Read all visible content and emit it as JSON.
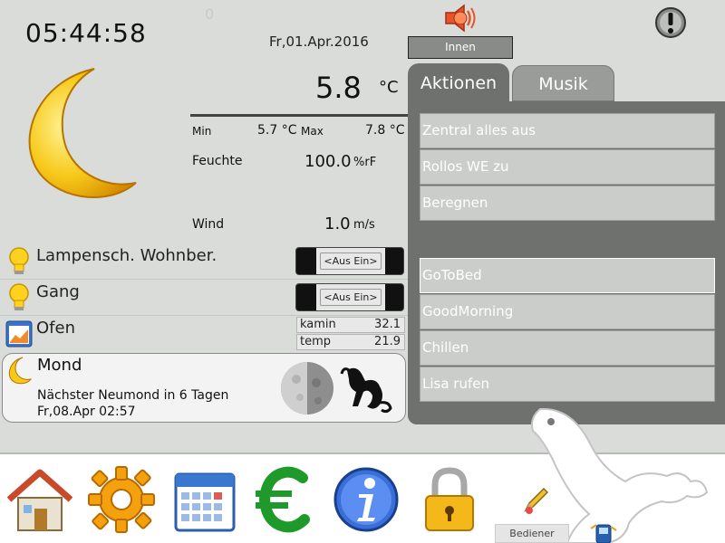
{
  "header": {
    "clock": "05:44:58",
    "hidden_zero": "0",
    "date": "Fr,01.Apr.2016",
    "location_button": "Innen"
  },
  "weather": {
    "temperature": "5.8",
    "temperature_unit": "°C",
    "min_label": "Min",
    "min_value": "5.7 °C",
    "max_label": "Max",
    "max_value": "7.8 °C",
    "humidity_label": "Feuchte",
    "humidity_value": "100.0",
    "humidity_unit": "%rF",
    "wind_label": "Wind",
    "wind_value": "1.0",
    "wind_unit": "m/s"
  },
  "devices": [
    {
      "label": "Lampensch. Wohnber.",
      "toggle": "<Aus Ein>"
    },
    {
      "label": "Gang",
      "toggle": "<Aus Ein>"
    }
  ],
  "oven": {
    "label": "Ofen",
    "readings": [
      {
        "name": "kamin",
        "value": "32.1"
      },
      {
        "name": "temp",
        "value": "21.9"
      }
    ]
  },
  "moon": {
    "title": "Mond",
    "next_new_moon": "Nächster Neumond in 6 Tagen",
    "next_new_moon_date": "Fr,08.Apr 02:57"
  },
  "tabs": {
    "actions": "Aktionen",
    "music": "Musik"
  },
  "actions": [
    "Zentral alles aus",
    "Rollos WE zu",
    "Beregnen",
    "GoToBed",
    "GoodMorning",
    "Chillen",
    "Lisa rufen"
  ],
  "footer": {
    "user_button": "Bediener"
  },
  "colors": {
    "panel": "#6e716e",
    "background": "#d9dcd9",
    "button": "#cbcdcb"
  },
  "icons": {
    "alarm": "speaker-alarm-icon",
    "warning": "exclamation-icon",
    "weather": "crescent-moon-icon",
    "dock": [
      "home-icon",
      "gear-icon",
      "calendar-icon",
      "euro-icon",
      "info-icon",
      "lock-icon"
    ]
  }
}
